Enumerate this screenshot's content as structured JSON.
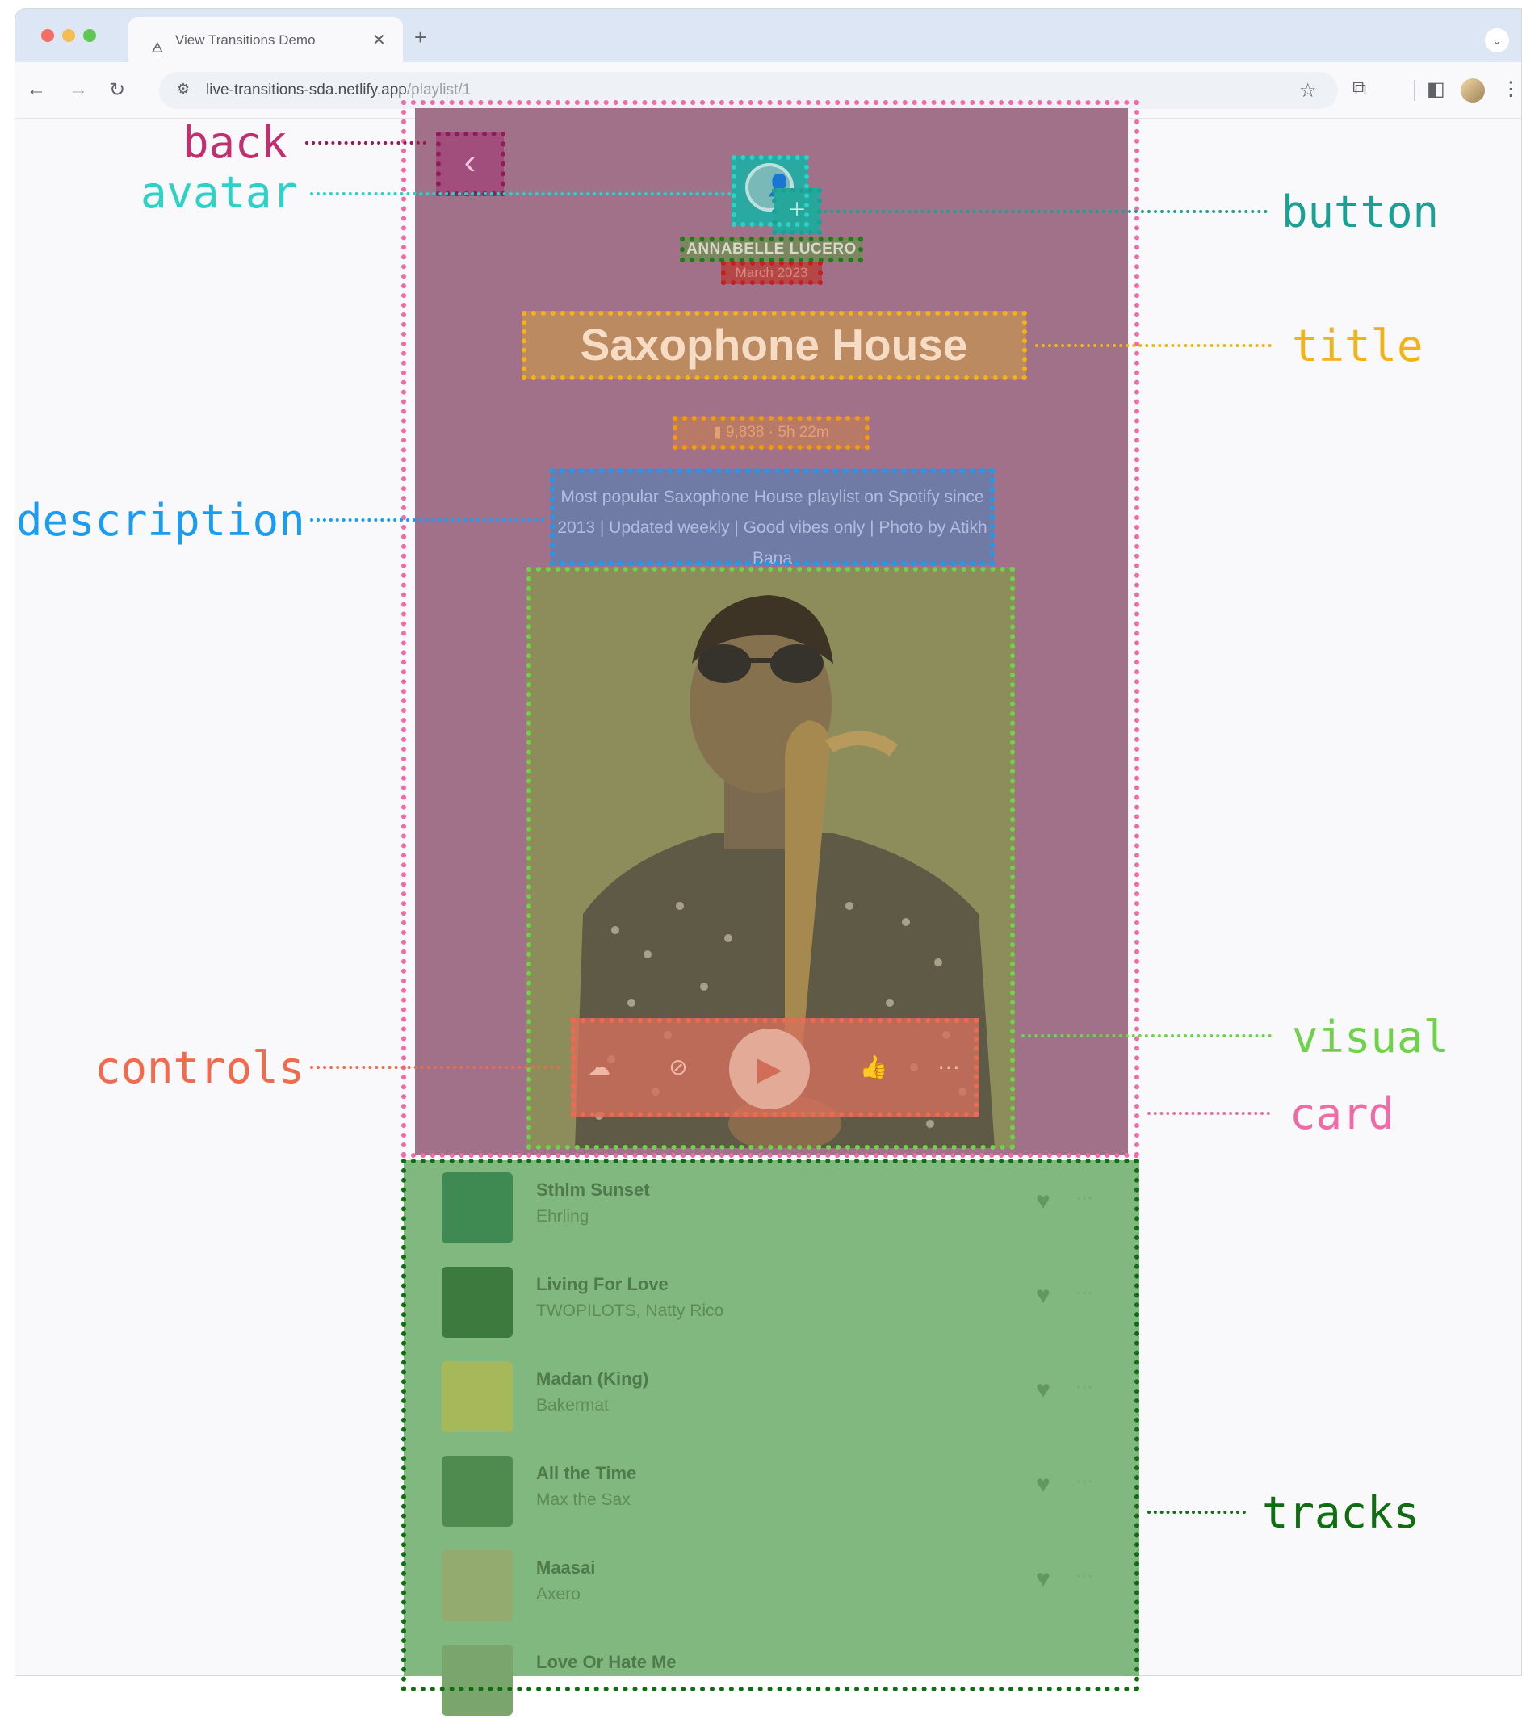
{
  "browser": {
    "tab_title": "View Transitions Demo",
    "url_host": "live-transitions-sda.netlify.app",
    "url_path": "/playlist/1"
  },
  "playlist": {
    "user_name": "ANNABELLE LUCERO",
    "user_date": "March 2023",
    "title": "Saxophone House",
    "stats": "9,838 · 5h 22m",
    "description": "Most popular Saxophone House playlist on Spotify since 2013 | Updated weekly | Good vibes only | Photo by Atikh Bana"
  },
  "tracks": [
    {
      "title": "Sthlm Sunset",
      "artist": "Ehrling",
      "art_color": "#3f8a52"
    },
    {
      "title": "Living For Love",
      "artist": "TWOPILOTS, Natty Rico",
      "art_color": "#3d7a3d"
    },
    {
      "title": "Madan (King)",
      "artist": "Bakermat",
      "art_color": "#a7b85a"
    },
    {
      "title": "All the Time",
      "artist": "Max the Sax",
      "art_color": "#4f8a4f"
    },
    {
      "title": "Maasai",
      "artist": "Axero",
      "art_color": "#93ab6f"
    },
    {
      "title": "Love Or Hate Me",
      "artist": "",
      "art_color": "#7aa66d"
    }
  ],
  "annotations": {
    "back": "back",
    "avatar": "avatar",
    "button": "button",
    "title": "title",
    "description": "description",
    "controls": "controls",
    "visual": "visual",
    "card": "card",
    "tracks": "tracks"
  },
  "colors": {
    "back": "#c0306e",
    "avatar": "#2ed1c6",
    "button": "#1aa094",
    "title": "#f2b21a",
    "description": "#1a9cf0",
    "controls": "#f06a4e",
    "visual": "#6fd24a",
    "card": "#f06ba6",
    "tracks": "#0f6e12",
    "username_box": "#1f7a1f",
    "date_box": "#c81e1e",
    "stats_box": "#f59a0a"
  }
}
